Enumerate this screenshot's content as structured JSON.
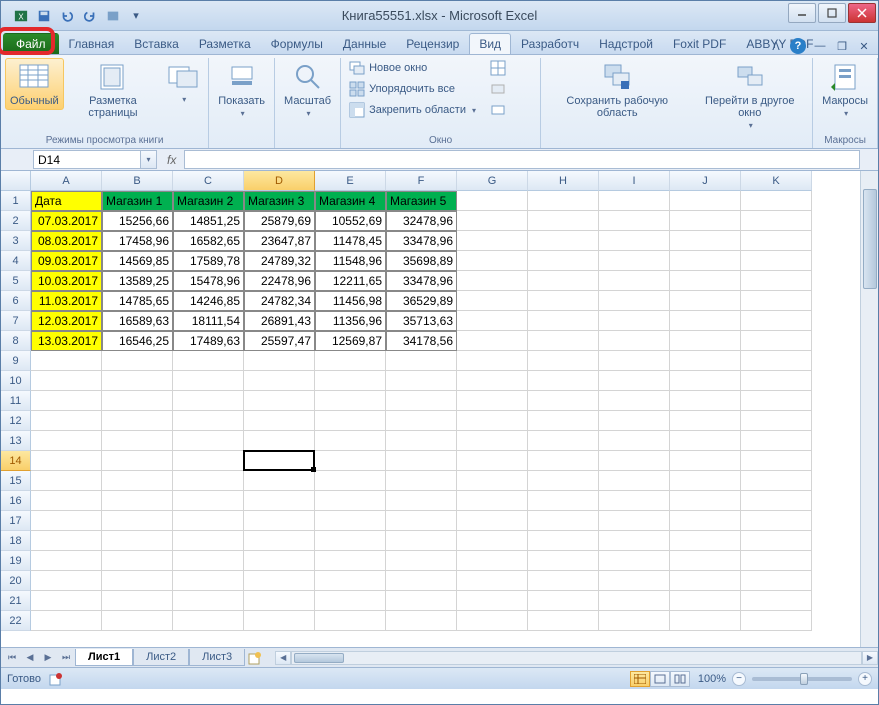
{
  "window": {
    "title": "Книга55551.xlsx - Microsoft Excel"
  },
  "tabs": {
    "file": "Файл",
    "home": "Главная",
    "insert": "Вставка",
    "pagelayout": "Разметка",
    "formulas": "Формулы",
    "data": "Данные",
    "review": "Рецензир",
    "view": "Вид",
    "developer": "Разработч",
    "addins": "Надстрой",
    "foxit": "Foxit PDF",
    "abbyy": "ABBYY PDF"
  },
  "ribbon": {
    "normal": "Обычный",
    "pagelayout": "Разметка страницы",
    "show": "Показать",
    "zoom": "Масштаб",
    "newwindow": "Новое окно",
    "arrangeall": "Упорядочить все",
    "freezepanes": "Закрепить области",
    "saveworkspace": "Сохранить рабочую область",
    "switchwindows": "Перейти в другое окно",
    "macros": "Макросы",
    "group_views": "Режимы просмотра книги",
    "group_window": "Окно",
    "group_macros": "Макросы"
  },
  "namebox": "D14",
  "columns": [
    "A",
    "B",
    "C",
    "D",
    "E",
    "F",
    "G",
    "H",
    "I",
    "J",
    "K"
  ],
  "selected_col_idx": 3,
  "rows_count": 22,
  "selected_row": 14,
  "chart_data": {
    "type": "table",
    "title": "",
    "headers": [
      "Дата",
      "Магазин 1",
      "Магазин 2",
      "Магазин 3",
      "Магазин 4",
      "Магазин 5"
    ],
    "rows": [
      [
        "07.03.2017",
        "15256,66",
        "14851,25",
        "25879,69",
        "10552,69",
        "32478,96"
      ],
      [
        "08.03.2017",
        "17458,96",
        "16582,65",
        "23647,87",
        "11478,45",
        "33478,96"
      ],
      [
        "09.03.2017",
        "14569,85",
        "17589,78",
        "24789,32",
        "11548,96",
        "35698,89"
      ],
      [
        "10.03.2017",
        "13589,25",
        "15478,96",
        "22478,96",
        "12211,65",
        "33478,96"
      ],
      [
        "11.03.2017",
        "14785,65",
        "14246,85",
        "24782,34",
        "11456,98",
        "36529,89"
      ],
      [
        "12.03.2017",
        "16589,63",
        "18111,54",
        "26891,43",
        "11356,96",
        "35713,63"
      ],
      [
        "13.03.2017",
        "16546,25",
        "17489,63",
        "25597,47",
        "12569,87",
        "34178,56"
      ]
    ]
  },
  "sheets": {
    "s1": "Лист1",
    "s2": "Лист2",
    "s3": "Лист3"
  },
  "status": {
    "ready": "Готово",
    "zoom": "100%"
  }
}
